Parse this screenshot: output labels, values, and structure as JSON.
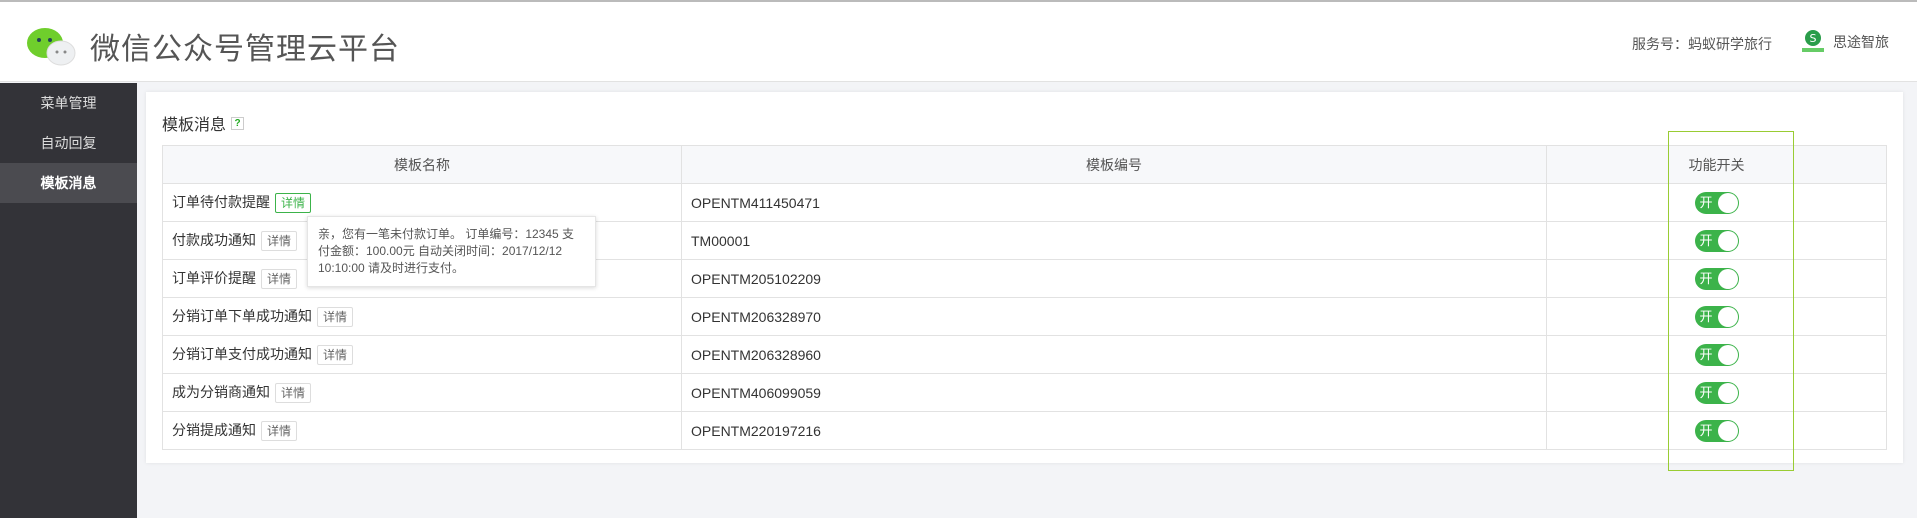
{
  "header": {
    "title": "微信公众号管理云平台",
    "service_label": "服务号：蚂蚁研学旅行",
    "brand": "思途智旅"
  },
  "sidebar": {
    "items": [
      {
        "label": "菜单管理"
      },
      {
        "label": "自动回复"
      },
      {
        "label": "模板消息",
        "active": true
      }
    ]
  },
  "main": {
    "title": "模板消息",
    "help_icon": "?",
    "columns": [
      "模板名称",
      "模板编号",
      "功能开关"
    ],
    "detail_label": "详情",
    "toggle_label": "开",
    "rows": [
      {
        "name": "订单待付款提醒",
        "code": "OPENTM411450471",
        "enabled": true
      },
      {
        "name": "付款成功通知",
        "code": "TM00001",
        "enabled": true
      },
      {
        "name": "订单评价提醒",
        "code": "OPENTM205102209",
        "enabled": true
      },
      {
        "name": "分销订单下单成功通知",
        "code": "OPENTM206328970",
        "enabled": true
      },
      {
        "name": "分销订单支付成功通知",
        "code": "OPENTM206328960",
        "enabled": true
      },
      {
        "name": "成为分销商通知",
        "code": "OPENTM406099059",
        "enabled": true
      },
      {
        "name": "分销提成通知",
        "code": "OPENTM220197216",
        "enabled": true
      }
    ],
    "tooltip": "亲，您有一笔未付款订单。 订单编号：12345 支付金额：100.00元 自动关闭时间：2017/12/12 10:10:00 请及时进行支付。"
  },
  "colors": {
    "accent": "#3cb34a",
    "sidebar": "#333338"
  }
}
